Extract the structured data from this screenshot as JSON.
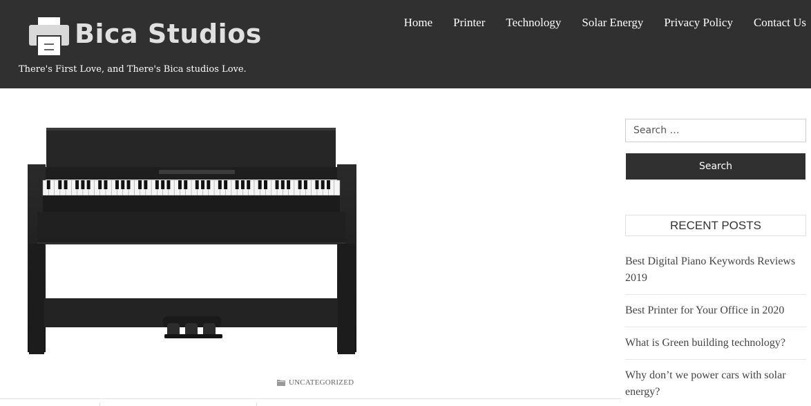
{
  "header": {
    "site_title": "Bica Studios",
    "tagline": "There's First Love, and There's Bica studios Love.",
    "logo_icon": "printer-icon",
    "background": "#303030"
  },
  "nav": {
    "items": [
      {
        "label": "Home"
      },
      {
        "label": "Printer"
      },
      {
        "label": "Technology"
      },
      {
        "label": "Solar Energy"
      },
      {
        "label": "Privacy Policy"
      },
      {
        "label": "Contact Us"
      }
    ]
  },
  "post": {
    "featured_image": "digital-piano-image",
    "category": "UNCATEGORIZED",
    "category_icon": "folder-icon"
  },
  "sidebar": {
    "search": {
      "placeholder": "Search …",
      "button_label": "Search"
    },
    "recent_posts": {
      "title": "RECENT POSTS",
      "items": [
        {
          "label": "Best Digital Piano Keywords Reviews 2019"
        },
        {
          "label": "Best Printer for Your Office in 2020"
        },
        {
          "label": "What is Green building technology?"
        },
        {
          "label": "Why don’t we power cars with solar energy?"
        }
      ]
    }
  }
}
